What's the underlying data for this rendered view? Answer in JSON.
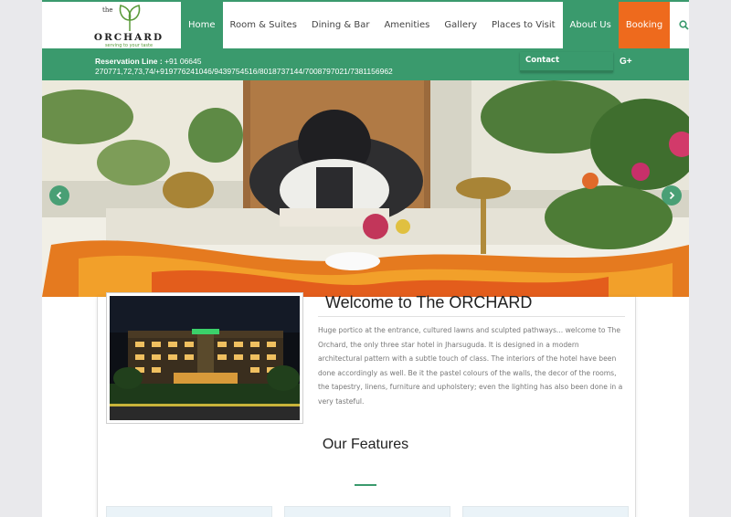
{
  "logo": {
    "the": "the",
    "brand": "ORCHARD",
    "tagline": "serving to your taste"
  },
  "nav": {
    "items": [
      {
        "label": "Home",
        "active": true
      },
      {
        "label": "Room & Suites"
      },
      {
        "label": "Dining & Bar"
      },
      {
        "label": "Amenities"
      },
      {
        "label": "Gallery"
      },
      {
        "label": "Places to Visit"
      },
      {
        "label": "About Us",
        "active": true
      },
      {
        "label": "Booking",
        "highlight": true
      }
    ],
    "search_icon": "search-icon"
  },
  "reservation": {
    "label": "Reservation Line :",
    "line1": "+91 06645",
    "line2": "270771,72,73,74/+919776241046/9439754516/8018737144/7008797021/7381156962"
  },
  "contact_menu": {
    "label": "Contact"
  },
  "social": {
    "gplus": "G+"
  },
  "welcome": {
    "title": "Welcome to The ORCHARD",
    "body": "Huge portico at the entrance, cultured lawns and sculpted pathways... welcome to The Orchard, the only three star hotel in Jharsuguda. It is designed in a modern architectural pattern with a subtle touch of class. The interiors of the hotel have been done accordingly as well. Be it the pastel colours of the walls, the decor of the rooms, the tapestry, linens, furniture and upholstery; even the lighting has also been done in a very tasteful."
  },
  "hotel_sign": "ORCHARD",
  "features_title": "Our Features",
  "colors": {
    "brand_green": "#3a9a6d",
    "booking_orange": "#ee6a1d"
  }
}
